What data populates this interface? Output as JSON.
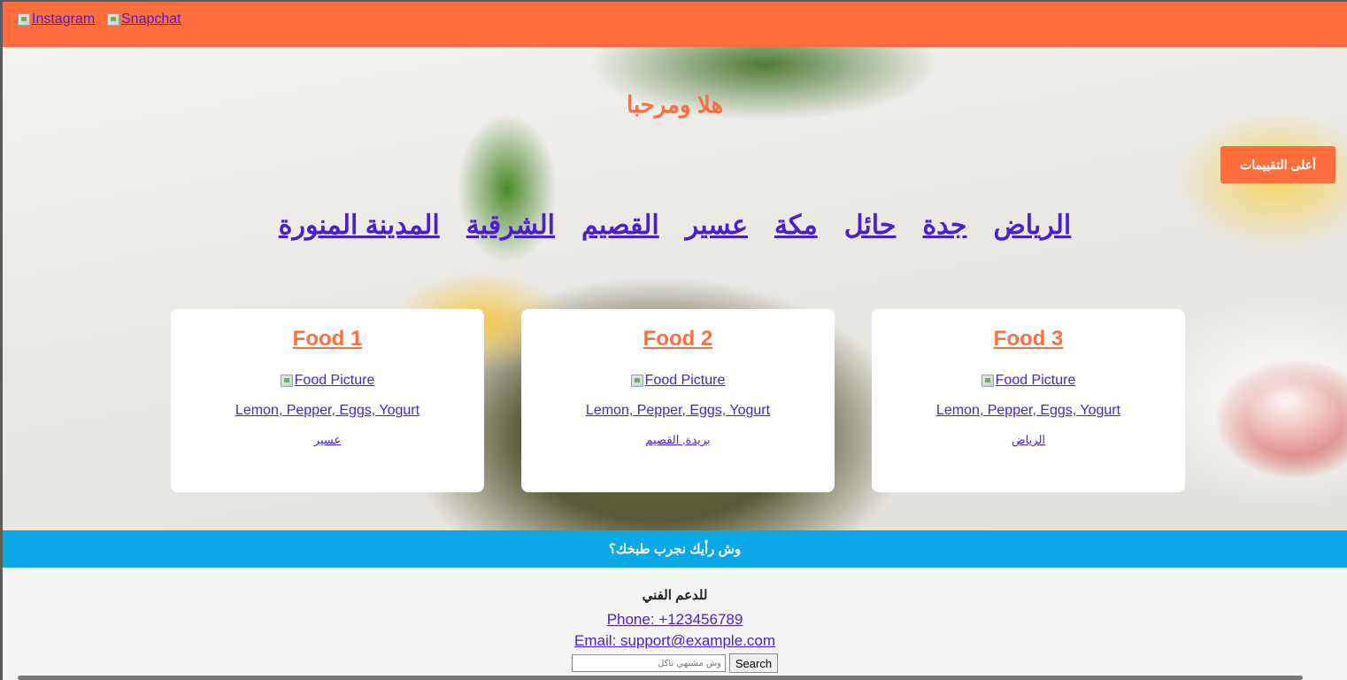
{
  "header": {
    "social_links": [
      {
        "label": "Instagram",
        "icon": "broken-image-icon"
      },
      {
        "label": "Snapchat",
        "icon": "broken-image-icon"
      }
    ]
  },
  "hero": {
    "title": "هلا ومرحبا",
    "top_rated_label": "أعلى التقييمات",
    "cities": [
      "الرياض",
      "جدة",
      "حائل",
      "مكة",
      "عسير",
      "القصيم",
      "الشرقية",
      "المدينة المنورة"
    ]
  },
  "cards": [
    {
      "title": "Food 1",
      "picture_alt": "Food Picture",
      "ingredients": "Lemon, Pepper, Eggs, Yogurt",
      "location": "عسير"
    },
    {
      "title": "Food 2",
      "picture_alt": "Food Picture",
      "ingredients": "Lemon, Pepper, Eggs, Yogurt",
      "location": "بريدة, القصيم"
    },
    {
      "title": "Food 3",
      "picture_alt": "Food Picture",
      "ingredients": "Lemon, Pepper, Eggs, Yogurt",
      "location": "الرياض"
    }
  ],
  "band": {
    "text": "وش رأيك نجرب طبخك؟"
  },
  "footer": {
    "support_title": "للدعم الفني",
    "phone": "Phone: +123456789",
    "email": "Email: support@example.com",
    "search_placeholder": "وش مشتهي تاكل",
    "search_button": "Search"
  },
  "colors": {
    "accent": "#ff6e3c",
    "band": "#0aa8e6",
    "link": "#4b1fd0"
  }
}
